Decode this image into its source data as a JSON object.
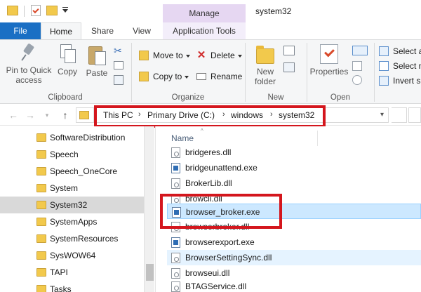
{
  "titlebar": {
    "window_title": "system32",
    "manage_label": "Manage"
  },
  "tabs": [
    {
      "label": "File"
    },
    {
      "label": "Home"
    },
    {
      "label": "Share"
    },
    {
      "label": "View"
    },
    {
      "label": "Application Tools"
    }
  ],
  "ribbon": {
    "clipboard": {
      "pin_line1": "Pin to Quick",
      "pin_line2": "access",
      "copy": "Copy",
      "paste": "Paste",
      "group": "Clipboard"
    },
    "organize": {
      "move_to": "Move to",
      "copy_to": "Copy to",
      "delete": "Delete",
      "rename": "Rename",
      "group": "Organize"
    },
    "new": {
      "new_folder_line1": "New",
      "new_folder_line2": "folder",
      "group": "New"
    },
    "open": {
      "properties": "Properties",
      "group": "Open"
    },
    "select": {
      "select_all": "Select a",
      "select_none": "Select n",
      "invert": "Invert s"
    }
  },
  "address": {
    "crumbs": [
      "This PC",
      "Primary Drive (C:)",
      "windows",
      "system32"
    ]
  },
  "navpane": {
    "items": [
      {
        "label": "SoftwareDistribution"
      },
      {
        "label": "Speech"
      },
      {
        "label": "Speech_OneCore"
      },
      {
        "label": "System"
      },
      {
        "label": "System32"
      },
      {
        "label": "SystemApps"
      },
      {
        "label": "SystemResources"
      },
      {
        "label": "SysWOW64"
      },
      {
        "label": "TAPI"
      },
      {
        "label": "Tasks"
      }
    ]
  },
  "filelist": {
    "column_name": "Name",
    "files": [
      {
        "name": "bridgeres.dll",
        "type": "dll"
      },
      {
        "name": "bridgeunattend.exe",
        "type": "exe"
      },
      {
        "name": "BrokerLib.dll",
        "type": "dll"
      },
      {
        "name": "browcli.dll",
        "type": "dll"
      },
      {
        "name": "browser_broker.exe",
        "type": "exe"
      },
      {
        "name": "browserbroker.dll",
        "type": "dll"
      },
      {
        "name": "browserexport.exe",
        "type": "exe"
      },
      {
        "name": "BrowserSettingSync.dll",
        "type": "dll"
      },
      {
        "name": "browseui.dll",
        "type": "dll"
      },
      {
        "name": "BTAGService.dll",
        "type": "dll"
      }
    ]
  },
  "colors": {
    "file_tab": "#1a6fc4",
    "manage_tab": "#e6d7f2",
    "annotation_red": "#d4161d",
    "selection": "#cce8ff"
  }
}
